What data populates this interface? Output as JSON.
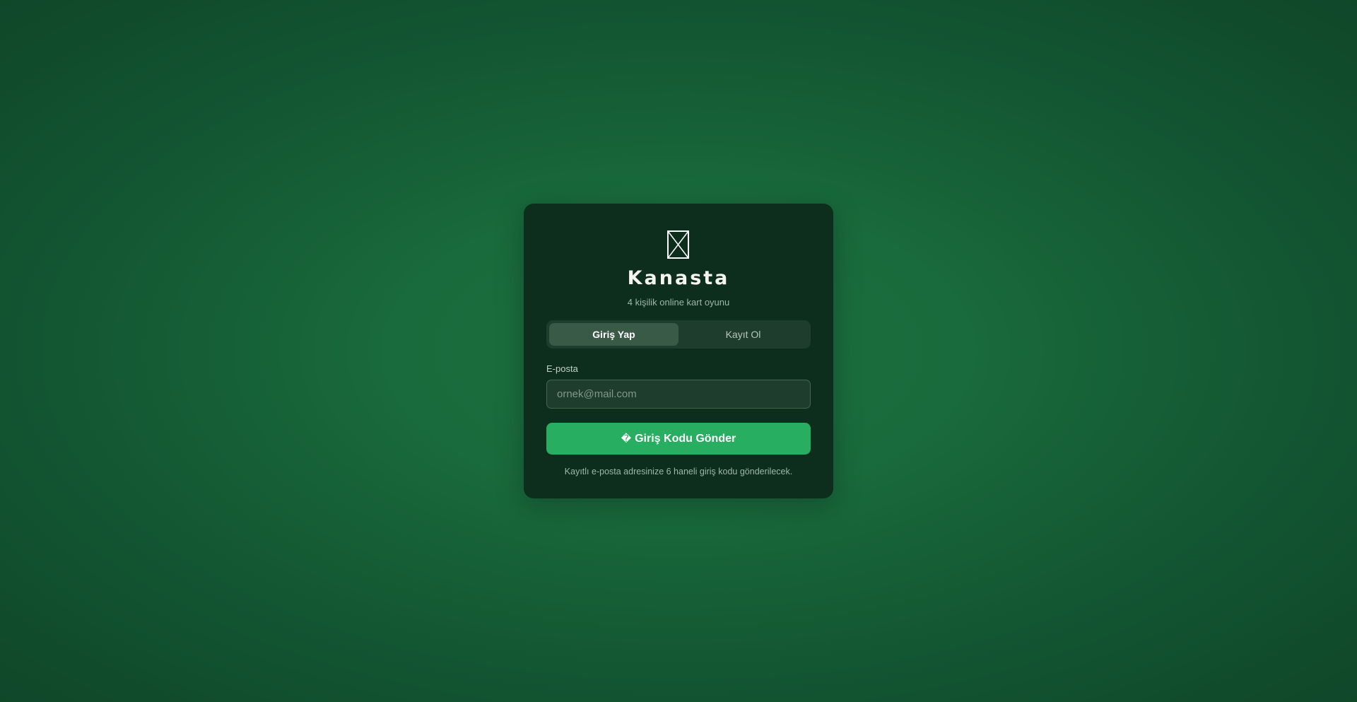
{
  "app": {
    "title": "Kanasta",
    "subtitle": "4 kişilik online kart oyunu",
    "logo_icon": "cards-icon"
  },
  "tabs": [
    {
      "label": "Giriş Yap",
      "active": true
    },
    {
      "label": "Kayıt Ol",
      "active": false
    }
  ],
  "form": {
    "email_label": "E-posta",
    "email_placeholder": "ornek@mail.com",
    "email_value": "",
    "submit_icon": "�",
    "submit_label": "Giriş Kodu Gönder",
    "hint": "Kayıtlı e-posta adresinize 6 haneli giriş kodu gönderilecek."
  },
  "colors": {
    "background": "#196a3c",
    "card": "#0d2e1c",
    "accent": "#27ae60",
    "tab_active": "#3a5a48"
  }
}
